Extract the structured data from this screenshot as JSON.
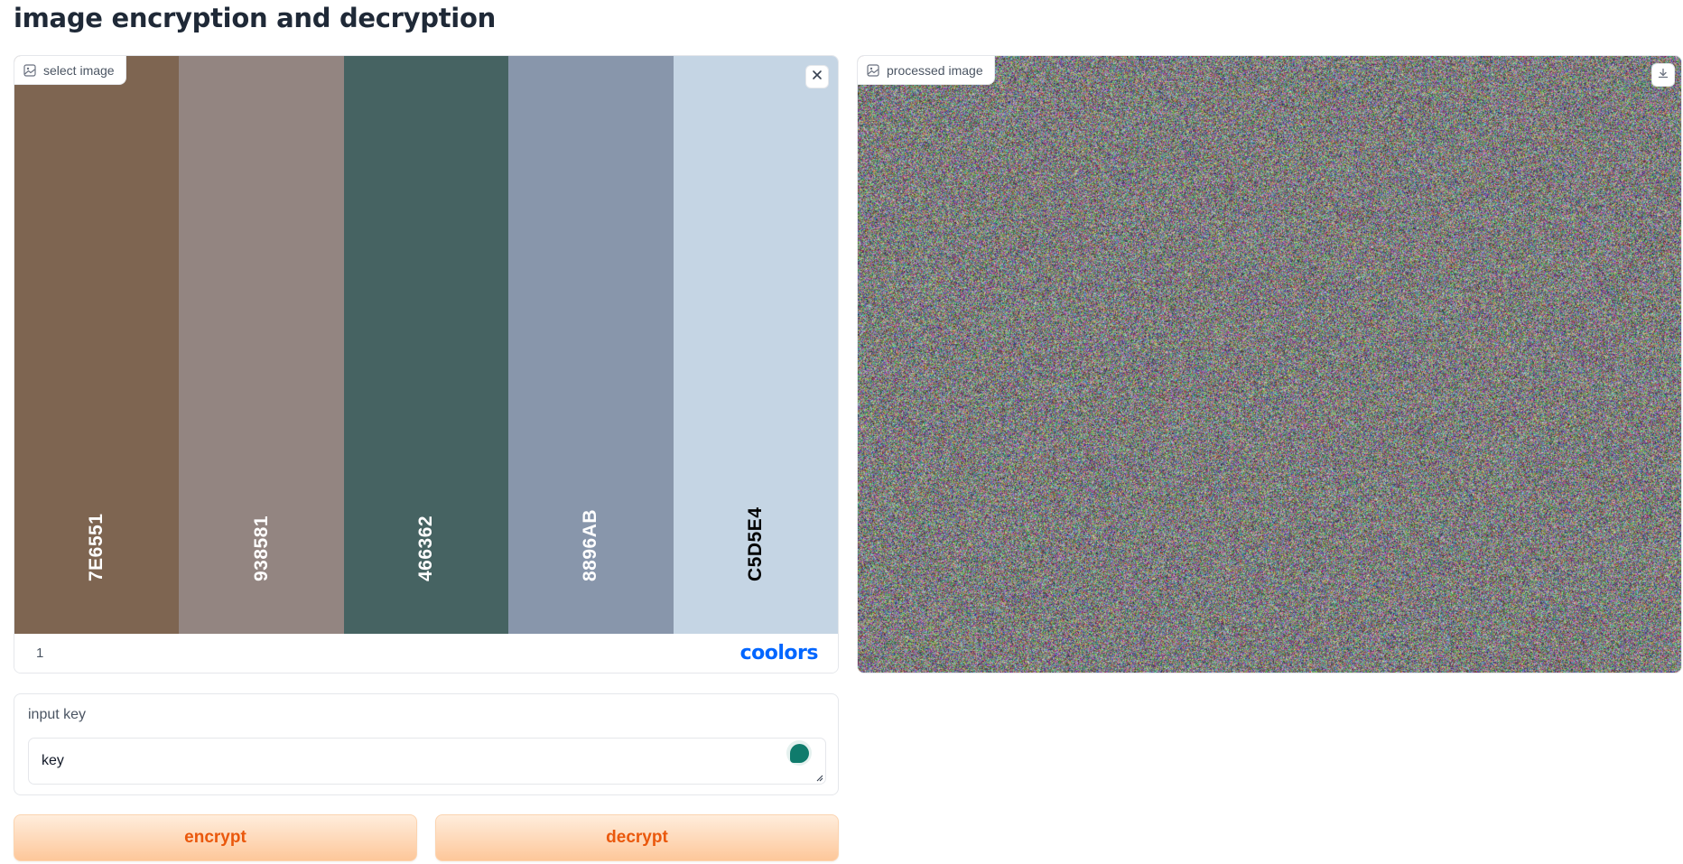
{
  "page": {
    "title": "image encryption and decryption"
  },
  "input_image": {
    "label": "select image",
    "label_icon": "image-icon",
    "close_icon": "close-icon",
    "palette": [
      {
        "code": "7E6551",
        "color": "#7E6551",
        "text_color": "#ffffff"
      },
      {
        "code": "938581",
        "color": "#938581",
        "text_color": "#ffffff"
      },
      {
        "code": "466362",
        "color": "#466362",
        "text_color": "#ffffff"
      },
      {
        "code": "8896AB",
        "color": "#8896AB",
        "text_color": "#ffffff"
      },
      {
        "code": "C5D5E4",
        "color": "#C5D5E4",
        "text_color": "#000000"
      }
    ],
    "page_number": "1",
    "brand": "coolors",
    "brand_color": "#0066ff"
  },
  "output_image": {
    "label": "processed image",
    "label_icon": "image-icon",
    "download_icon": "download-icon"
  },
  "key_input": {
    "label": "input key",
    "value": "key",
    "assistant_icon": "grammar-assistant-icon"
  },
  "buttons": {
    "encrypt": "encrypt",
    "decrypt": "decrypt",
    "accent_color": "#ea580c"
  }
}
